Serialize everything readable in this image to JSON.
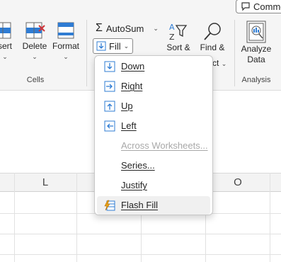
{
  "comments_button": {
    "label": "Comme",
    "icon": "comment-icon"
  },
  "cells_group": {
    "label": "Cells",
    "insert": {
      "label": "sert"
    },
    "delete": {
      "label": "Delete"
    },
    "format": {
      "label": "Format"
    }
  },
  "editing_group": {
    "autosum": {
      "label": "AutoSum",
      "icon": "sigma-icon"
    },
    "fill": {
      "label": "Fill",
      "icon": "fill-down-icon"
    },
    "sort": {
      "label": "Sort &"
    },
    "find": {
      "label": "Find &",
      "label_line2": "ct"
    }
  },
  "analysis_group": {
    "label": "Analysis",
    "analyze": {
      "label_line1": "Analyze",
      "label_line2": "Data"
    }
  },
  "sheet": {
    "columns": [
      "L",
      "O"
    ]
  },
  "fill_menu": {
    "items": [
      {
        "label": "Down",
        "icon": "arrow-down-box-icon",
        "disabled": false
      },
      {
        "label": "Right",
        "icon": "arrow-right-box-icon",
        "disabled": false
      },
      {
        "label": "Up",
        "icon": "arrow-up-box-icon",
        "disabled": false
      },
      {
        "label": "Left",
        "icon": "arrow-left-box-icon",
        "disabled": false
      },
      {
        "label": "Across Worksheets...",
        "icon": "",
        "disabled": true
      },
      {
        "label": "Series...",
        "icon": "",
        "disabled": false
      },
      {
        "label": "Justify",
        "icon": "",
        "disabled": false
      },
      {
        "label": "Flash Fill",
        "icon": "flash-fill-icon",
        "disabled": false,
        "hovered": true
      }
    ]
  },
  "colors": {
    "accent": "#2f7cd3",
    "ribbon_bg": "#f5f5f5",
    "header_bg": "#f3f3f3"
  }
}
